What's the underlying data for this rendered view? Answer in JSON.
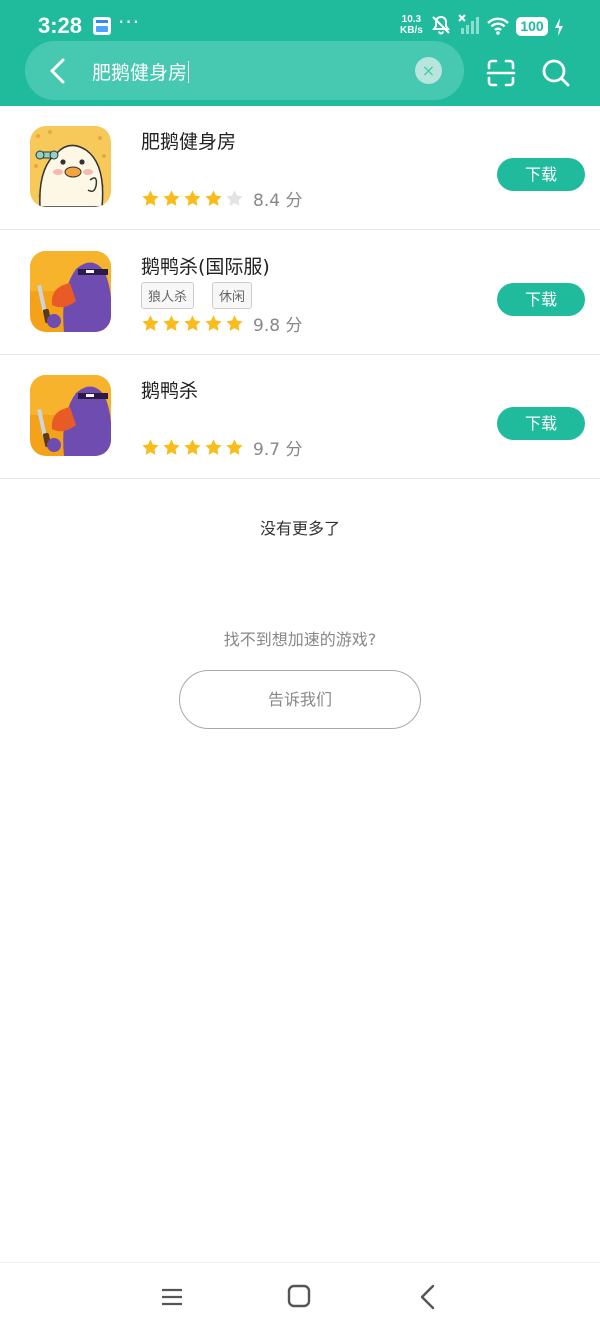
{
  "status_bar": {
    "time": "3:28",
    "dots": "···",
    "net_speed": "10.3",
    "net_unit": "KB/s",
    "battery": "100"
  },
  "search": {
    "query": "肥鹅健身房",
    "clear_symbol": "×"
  },
  "results": [
    {
      "name": "肥鹅健身房",
      "tags": [],
      "rating_stars": 4,
      "score_text": "8.4 分",
      "button": "下载",
      "icon": "fat-goose-icon"
    },
    {
      "name": "鹅鸭杀(国际服)",
      "tags": [
        "狼人杀",
        "休闲"
      ],
      "rating_stars": 5,
      "score_text": "9.8 分",
      "button": "下载",
      "icon": "goose-duck-icon"
    },
    {
      "name": "鹅鸭杀",
      "tags": [],
      "rating_stars": 5,
      "score_text": "9.7 分",
      "button": "下载",
      "icon": "goose-duck-icon"
    }
  ],
  "footer": {
    "no_more": "没有更多了",
    "cant_find": "找不到想加速的游戏?",
    "tell_us": "告诉我们"
  },
  "colors": {
    "accent": "#1fbb9c",
    "star": "#f8bd1c",
    "star_empty": "#e3e3e3"
  }
}
